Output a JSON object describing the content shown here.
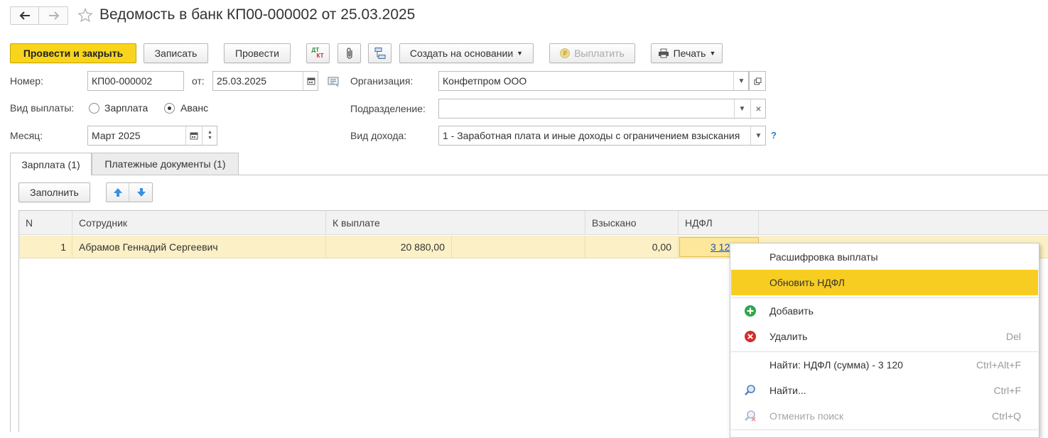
{
  "window": {
    "title": "Ведомость в банк КП00-000002 от 25.03.2025",
    "back_icon": "arrow-left-icon",
    "forward_icon": "arrow-right-icon",
    "favorite_icon": "star-outline-icon"
  },
  "toolbar": {
    "post_close_label": "Провести и закрыть",
    "save_label": "Записать",
    "post_label": "Провести",
    "dtkt_icon": "dt-kt-icon",
    "dt_text": "ДТ",
    "kt_text": "КТ",
    "attach_icon": "paperclip-icon",
    "structure_icon": "structure-icon",
    "create_based_label": "Создать на основании",
    "pay_label": "Выплатить",
    "print_label": "Печать"
  },
  "form": {
    "number_label": "Номер:",
    "number_value": "КП00-000002",
    "from_label": "от:",
    "date_value": "25.03.2025",
    "org_label": "Организация:",
    "org_value": "Конфетпром ООО",
    "pay_type_label": "Вид выплаты:",
    "pay_type_options": [
      "Зарплата",
      "Аванс"
    ],
    "pay_type_selected": "Аванс",
    "dept_label": "Подразделение:",
    "dept_value": "",
    "month_label": "Месяц:",
    "month_value": "Март 2025",
    "income_type_label": "Вид дохода:",
    "income_type_value": "1 - Заработная плата и иные доходы с ограничением взыскания",
    "help_mark": "?"
  },
  "tabs": [
    {
      "label": "Зарплата (1)",
      "active": true
    },
    {
      "label": "Платежные документы (1)",
      "active": false
    }
  ],
  "grid_toolbar": {
    "fill_label": "Заполнить",
    "up_icon": "arrow-up-icon",
    "down_icon": "arrow-down-icon"
  },
  "table": {
    "columns": [
      "N",
      "Сотрудник",
      "К выплате",
      "Взыскано",
      "НДФЛ"
    ],
    "rows": [
      {
        "n": "1",
        "employee": "Абрамов Геннадий Сергеевич",
        "to_pay": "20 880,00",
        "withheld": "0,00",
        "ndfl": "3 12"
      }
    ]
  },
  "context_menu": {
    "items": [
      {
        "label": "Расшифровка выплаты",
        "shortcut": "",
        "icon": "",
        "highlighted": false,
        "disabled": false
      },
      {
        "label": "Обновить НДФЛ",
        "shortcut": "",
        "icon": "",
        "highlighted": true,
        "disabled": false
      },
      {
        "label": "Добавить",
        "shortcut": "",
        "icon": "add-green-icon",
        "highlighted": false,
        "disabled": false
      },
      {
        "label": "Удалить",
        "shortcut": "Del",
        "icon": "delete-red-icon",
        "highlighted": false,
        "disabled": false
      },
      {
        "label": "Найти: НДФЛ (сумма) - 3 120",
        "shortcut": "Ctrl+Alt+F",
        "icon": "",
        "highlighted": false,
        "disabled": false
      },
      {
        "label": "Найти...",
        "shortcut": "Ctrl+F",
        "icon": "search-icon",
        "highlighted": false,
        "disabled": false
      },
      {
        "label": "Отменить поиск",
        "shortcut": "Ctrl+Q",
        "icon": "cancel-search-icon",
        "highlighted": false,
        "disabled": true
      }
    ]
  },
  "colors": {
    "primary_button": "#f8d41c",
    "selected_row": "#fbf0c6",
    "menu_highlight": "#f8cd21",
    "link": "#1a55c0"
  }
}
